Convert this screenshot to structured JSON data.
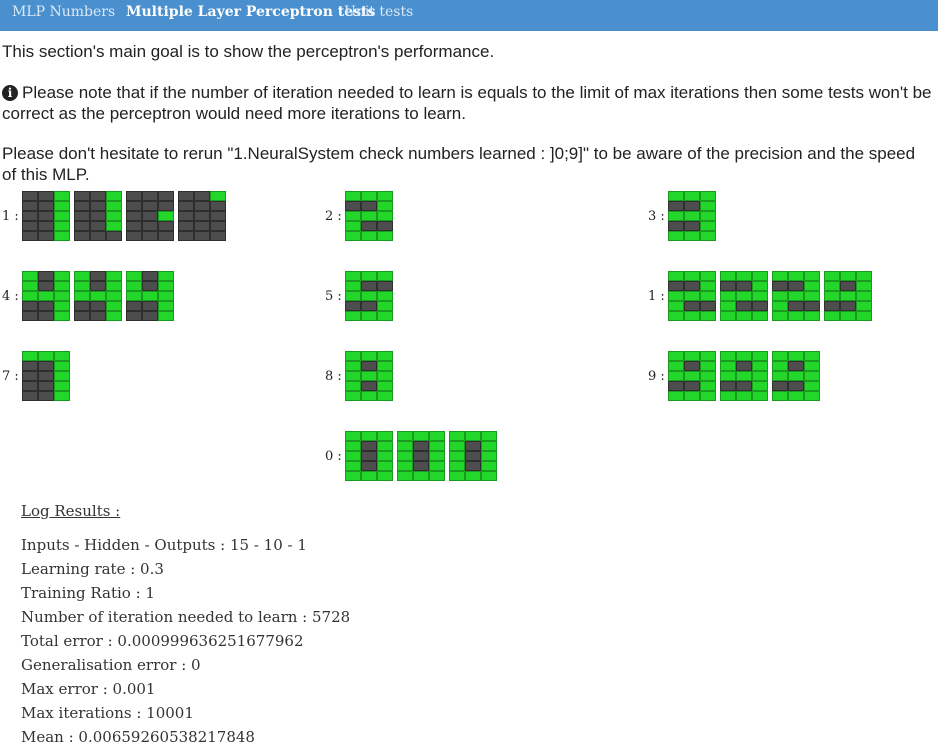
{
  "nav": {
    "tabs": [
      {
        "label": "MLP Numbers"
      },
      {
        "label": "Multiple Layer Perceptron tests"
      },
      {
        "label": "Unit tests"
      }
    ]
  },
  "intro": {
    "goal": "This section's main goal is to show the perceptron's performance.",
    "note": "Please note that if the number of iteration needed to learn is equals to the limit of max iterations then some tests won't be correct as the perceptron would need more iterations to learn.",
    "rerun": "Please don't hesitate to rerun \"1.NeuralSystem check numbers learned : ]0;9]\" to be aware of the precision and the speed of this MLP.",
    "info_icon": "info-circle-icon"
  },
  "colors": {
    "on": "#22d62a",
    "off": "#4d4d4d",
    "nav": "#4a8fce"
  },
  "tests": [
    {
      "label": "1 :",
      "digits": [
        "001001001001001",
        "001001001001000",
        "000000001000000",
        "001000000000000"
      ]
    },
    {
      "label": "2 :",
      "digits": [
        "111001111100111"
      ]
    },
    {
      "label": "3 :",
      "digits": [
        "111001111001111"
      ]
    },
    {
      "label": "4 :",
      "digits": [
        "101101111001001",
        "101101111001001",
        "101101111001001"
      ]
    },
    {
      "label": "5 :",
      "digits": [
        "111100111001111"
      ]
    },
    {
      "label": "1 :",
      "digits": [
        "111001111100111",
        "111001111100111",
        "111001111100111",
        "111101111001111"
      ]
    },
    {
      "label": "7 :",
      "digits": [
        "111001001001001"
      ]
    },
    {
      "label": "8 :",
      "digits": [
        "111101111101111"
      ]
    },
    {
      "label": "9 :",
      "digits": [
        "111101111001111",
        "111101111001111",
        "111101111001111"
      ]
    },
    {
      "label": "0 :",
      "digits": [
        "111101101101111",
        "111101101101111",
        "111101101101111"
      ]
    }
  ],
  "log": {
    "title": "Log Results :",
    "lines": [
      "Inputs - Hidden - Outputs : 15 - 10 - 1",
      "Learning rate : 0.3",
      "Training Ratio : 1",
      "Number of iteration needed to learn : 5728",
      "Total error : 0.000999636251677962",
      "Generalisation error : 0",
      "Max error : 0.001",
      "Max iterations : 10001",
      "Mean : 0.00659260538217848"
    ]
  }
}
